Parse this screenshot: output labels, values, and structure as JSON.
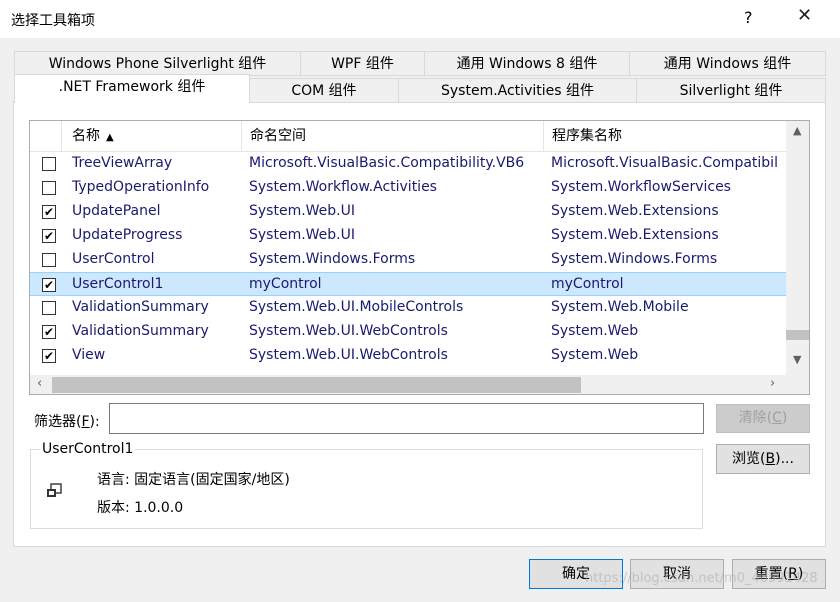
{
  "window": {
    "title": "选择工具箱项",
    "help": "?",
    "close": "✕"
  },
  "tabs_top": [
    "Windows Phone Silverlight 组件",
    "WPF 组件",
    "通用 Windows 8 组件",
    "通用 Windows 组件"
  ],
  "tabs_bottom": [
    ".NET Framework 组件",
    "COM 组件",
    "System.Activities 组件",
    "Silverlight 组件"
  ],
  "active_tab": ".NET Framework 组件",
  "table": {
    "headers": {
      "name": "名称",
      "namespace": "命名空间",
      "assembly": "程序集名称"
    },
    "sort_indicator": "▲",
    "rows": [
      {
        "checked": false,
        "name": "TreeViewArray",
        "namespace": "Microsoft.VisualBasic.Compatibility.VB6",
        "assembly": "Microsoft.VisualBasic.Compatibil"
      },
      {
        "checked": false,
        "name": "TypedOperationInfo",
        "namespace": "System.Workflow.Activities",
        "assembly": "System.WorkflowServices"
      },
      {
        "checked": true,
        "name": "UpdatePanel",
        "namespace": "System.Web.UI",
        "assembly": "System.Web.Extensions"
      },
      {
        "checked": true,
        "name": "UpdateProgress",
        "namespace": "System.Web.UI",
        "assembly": "System.Web.Extensions"
      },
      {
        "checked": false,
        "name": "UserControl",
        "namespace": "System.Windows.Forms",
        "assembly": "System.Windows.Forms"
      },
      {
        "checked": true,
        "name": "UserControl1",
        "namespace": "myControl",
        "assembly": "myControl",
        "selected": true
      },
      {
        "checked": false,
        "name": "ValidationSummary",
        "namespace": "System.Web.UI.MobileControls",
        "assembly": "System.Web.Mobile"
      },
      {
        "checked": true,
        "name": "ValidationSummary",
        "namespace": "System.Web.UI.WebControls",
        "assembly": "System.Web"
      },
      {
        "checked": true,
        "name": "View",
        "namespace": "System.Web.UI.WebControls",
        "assembly": "System.Web"
      }
    ]
  },
  "filter": {
    "label_prefix": "筛选器(",
    "label_key": "F",
    "label_suffix": "):",
    "value": ""
  },
  "buttons": {
    "clear_prefix": "清除(",
    "clear_key": "C",
    "clear_suffix": ")",
    "browse_prefix": "浏览(",
    "browse_key": "B",
    "browse_suffix": ")...",
    "ok": "确定",
    "cancel": "取消",
    "reset_prefix": "重置(",
    "reset_key": "R",
    "reset_suffix": ")"
  },
  "info": {
    "title": "UserControl1",
    "language": "语言: 固定语言(固定国家/地区)",
    "version": "版本: 1.0.0.0"
  },
  "watermark": "https://blog.csdn.net/m0_46591428",
  "colors": {
    "selection": "#cce8ff",
    "link_text": "#1a1a6e",
    "accent": "#0078d7"
  }
}
